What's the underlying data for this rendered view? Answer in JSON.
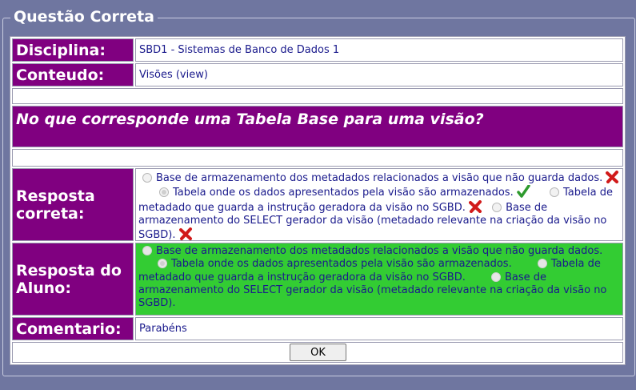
{
  "dialog": {
    "title": "Questão Correta"
  },
  "fields": {
    "disciplina_label": "Disciplina:",
    "disciplina_value": "SBD1 - Sistemas de Banco de Dados 1",
    "conteudo_label": "Conteudo:",
    "conteudo_value": "Visões (view)",
    "comentario_label": "Comentario:",
    "comentario_value": "Parabéns"
  },
  "question": {
    "text": "No que corresponde uma Tabela Base para uma visão?"
  },
  "correct_answer": {
    "label_line1": "Resposta",
    "label_line2": "correta:",
    "options": [
      {
        "text": "Base de armazenamento dos metadados relacionados a visão que não guarda dados.",
        "selected": false,
        "result_icon": "cross-icon"
      },
      {
        "text": "Tabela onde os dados apresentados pela visão são armazenados.",
        "selected": true,
        "result_icon": "check-icon"
      },
      {
        "text": "Tabela de metadado que guarda a instrução geradora da visão no SGBD.",
        "selected": false,
        "result_icon": "cross-icon"
      },
      {
        "text": "Base de armazenamento do SELECT gerador da visão (metadado relevante na criação da visão no SGBD).",
        "selected": false,
        "result_icon": "cross-icon"
      }
    ]
  },
  "student_answer": {
    "label_line1": "Resposta do",
    "label_line2": "Aluno:",
    "options": [
      {
        "text": "Base de armazenamento dos metadados relacionados a visão que não guarda dados.",
        "selected": false
      },
      {
        "text": "Tabela onde os dados apresentados pela visão são armazenados.",
        "selected": true
      },
      {
        "text": "Tabela de metadado que guarda a instrução geradora da visão no SGBD.",
        "selected": false
      },
      {
        "text": "Base de armazenamento do SELECT gerador da visão (metadado relevante na criação da visão no SGBD).",
        "selected": false
      }
    ]
  },
  "buttons": {
    "ok_label": "OK"
  },
  "colors": {
    "background": "#6f76a0",
    "label_purple": "#800080",
    "student_green": "#33cc33",
    "text_navy": "#1a1a8c",
    "cross_red": "#d11a1a",
    "check_green": "#2e9a2e"
  }
}
